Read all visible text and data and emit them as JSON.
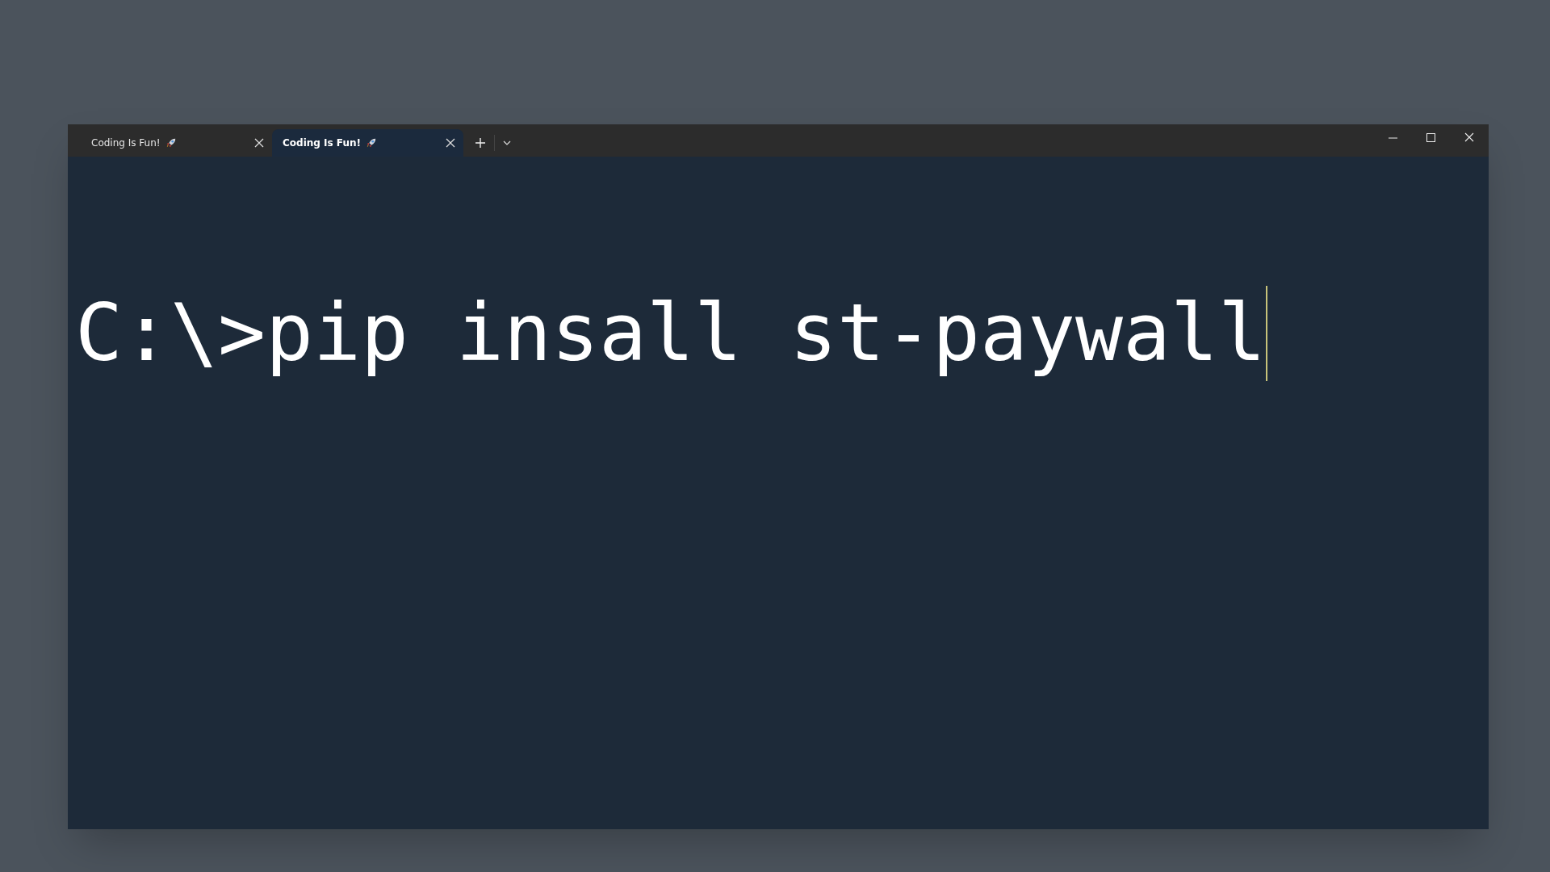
{
  "tabs": [
    {
      "title": "Coding Is Fun!",
      "selected": false
    },
    {
      "title": "Coding Is Fun!",
      "selected": true
    }
  ],
  "terminal": {
    "line": "C:\\>pip insall st-paywall",
    "cursor": true
  }
}
